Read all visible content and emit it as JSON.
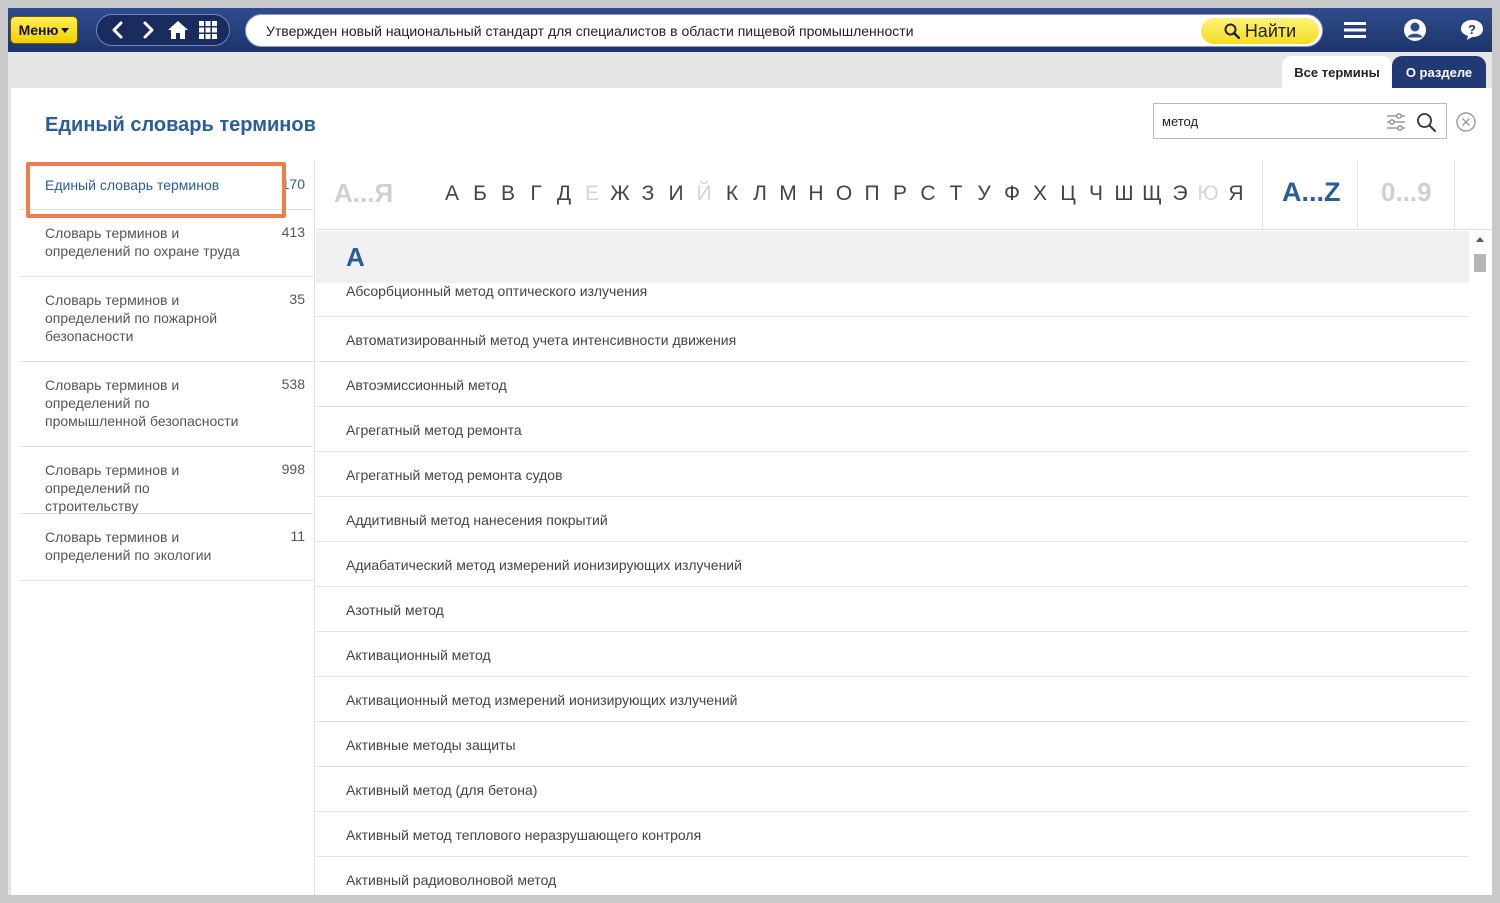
{
  "topbar": {
    "menu_label": "Меню",
    "search_text": "Утвержден новый национальный стандарт для специалистов в области пищевой промышленности",
    "find_label": "Найти"
  },
  "tabs": [
    {
      "label": "Все термины",
      "active": true
    },
    {
      "label": "О разделе",
      "active": false
    }
  ],
  "page_title": "Единый словарь терминов",
  "search": {
    "value": "метод"
  },
  "sidebar": {
    "items": [
      {
        "label": "Единый словарь терминов",
        "count": "170",
        "active": true
      },
      {
        "label": "Словарь терминов и определений по охране труда",
        "count": "413"
      },
      {
        "label": "Словарь терминов и определений по пожарной безопасности",
        "count": "35"
      },
      {
        "label": "Словарь терминов и определений по промышленной безопасности",
        "count": "538"
      },
      {
        "label": "Словарь терминов и определений по строительству",
        "count": "998"
      },
      {
        "label": "Словарь терминов и определений по экологии",
        "count": "11"
      }
    ]
  },
  "alphabet": {
    "ru_range": "А...Я",
    "letters": [
      "А",
      "Б",
      "В",
      "Г",
      "Д",
      "Е",
      "Ж",
      "З",
      "И",
      "Й",
      "К",
      "Л",
      "М",
      "Н",
      "О",
      "П",
      "Р",
      "С",
      "Т",
      "У",
      "Ф",
      "Х",
      "Ц",
      "Ч",
      "Ш",
      "Щ",
      "Э",
      "Ю",
      "Я"
    ],
    "dim_letters": [
      "Е",
      "Й",
      "Ю"
    ],
    "latin_range": "A...Z",
    "num_range": "0...9"
  },
  "terms": {
    "letter": "А",
    "items": [
      "Абсорбционный метод оптического излучения",
      "Автоматизированный метод учета интенсивности движения",
      "Автоэмиссионный метод",
      "Агрегатный метод ремонта",
      "Агрегатный метод ремонта судов",
      "Аддитивный метод нанесения покрытий",
      "Адиабатический метод измерений ионизирующих излучений",
      "Азотный метод",
      "Активационный метод",
      "Активационный метод измерений ионизирующих излучений",
      "Активные методы защиты",
      "Активный метод (для бетона)",
      "Активный метод теплового неразрушающего контроля",
      "Активный радиоволновой метод"
    ]
  },
  "colors": {
    "accent": "#2b5e99",
    "topbar": "#223a74",
    "highlight": "#ee7d4e",
    "menu_button": "#f6dc1c"
  }
}
